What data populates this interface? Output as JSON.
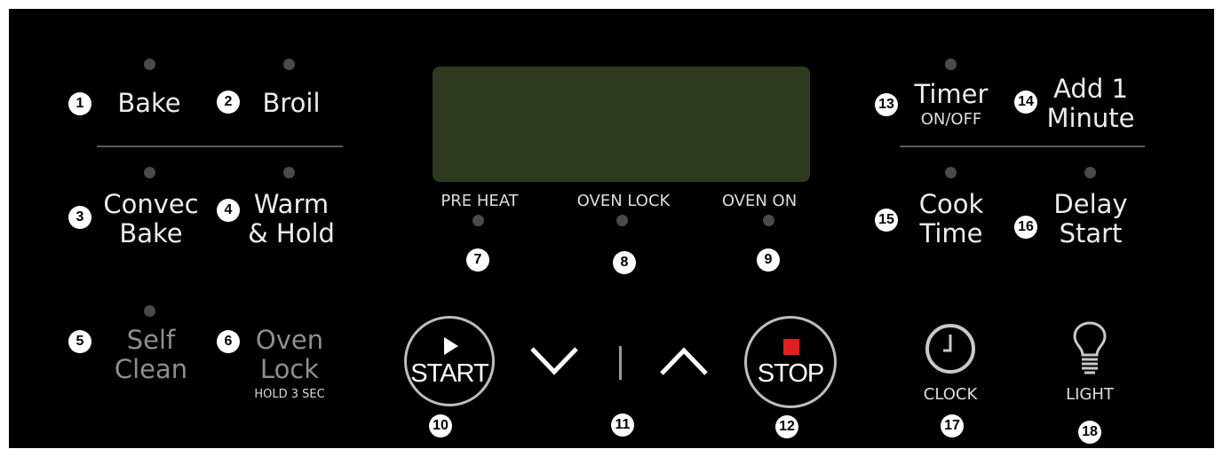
{
  "buttons": {
    "bake": {
      "num": "1",
      "label": "Bake"
    },
    "broil": {
      "num": "2",
      "label": "Broil"
    },
    "convec_bake": {
      "num": "3",
      "line1": "Convec",
      "line2": "Bake"
    },
    "warm_hold": {
      "num": "4",
      "line1": "Warm",
      "line2": "& Hold"
    },
    "self_clean": {
      "num": "5",
      "line1": "Self",
      "line2": "Clean"
    },
    "oven_lock": {
      "num": "6",
      "line1": "Oven",
      "line2": "Lock",
      "note": "HOLD 3 SEC"
    },
    "start": {
      "num": "10",
      "label": "START"
    },
    "arrows": {
      "num": "11"
    },
    "stop": {
      "num": "12",
      "label": "STOP"
    },
    "timer": {
      "num": "13",
      "label": "Timer",
      "sub": "ON/OFF"
    },
    "add_minute": {
      "num": "14",
      "line1": "Add 1",
      "line2": "Minute"
    },
    "cook_time": {
      "num": "15",
      "line1": "Cook",
      "line2": "Time"
    },
    "delay_start": {
      "num": "16",
      "line1": "Delay",
      "line2": "Start"
    },
    "clock": {
      "num": "17",
      "label": "CLOCK"
    },
    "light": {
      "num": "18",
      "label": "LIGHT"
    }
  },
  "indicators": {
    "pre_heat": {
      "num": "7",
      "label": "PRE HEAT"
    },
    "oven_lock": {
      "num": "8",
      "label": "OVEN LOCK"
    },
    "oven_on": {
      "num": "9",
      "label": "OVEN ON"
    }
  },
  "colors": {
    "panel": "#000000",
    "display": "#2e3a20",
    "stop_square": "#e02020",
    "led_off": "#4a4a4a"
  },
  "icons": [
    "play-icon",
    "stop-square-icon",
    "chevron-down-icon",
    "chevron-up-icon",
    "clock-icon",
    "light-bulb-icon"
  ]
}
